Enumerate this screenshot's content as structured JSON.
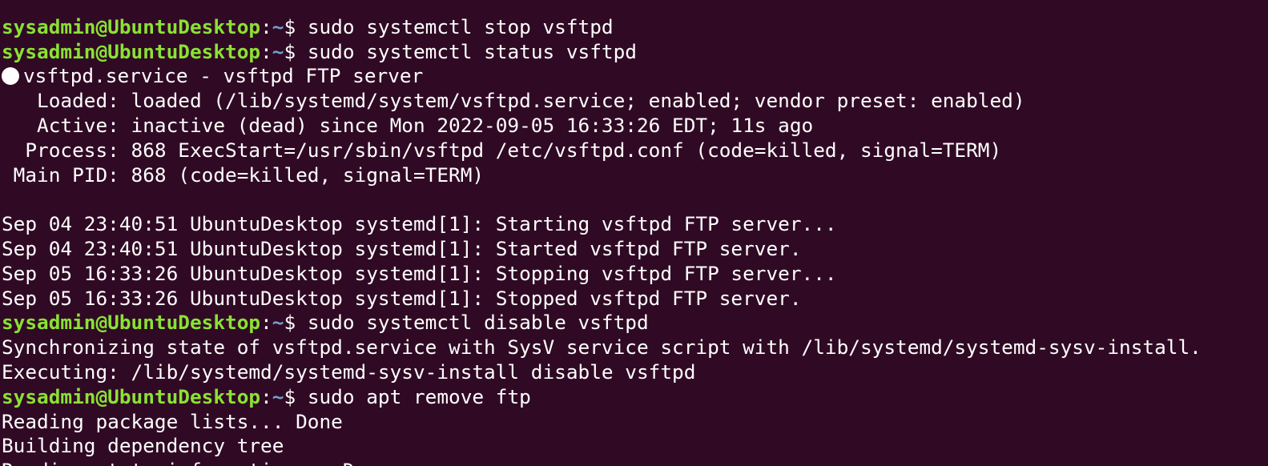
{
  "terminal": {
    "colors": {
      "background": "#300a24",
      "foreground": "#ffffff",
      "prompt_user": "#8ae234",
      "prompt_path": "#729fcf"
    },
    "prompt": {
      "user_host": "sysadmin@UbuntuDesktop",
      "colon": ":",
      "path": "~",
      "symbol": "$ "
    },
    "lines": [
      {
        "type": "output",
        "text": ""
      },
      {
        "type": "prompt",
        "command": "sudo systemctl stop vsftpd"
      },
      {
        "type": "prompt",
        "command": "sudo systemctl status vsftpd"
      },
      {
        "type": "status",
        "text": "vsftpd.service - vsftpd FTP server"
      },
      {
        "type": "output",
        "text": "   Loaded: loaded (/lib/systemd/system/vsftpd.service; enabled; vendor preset: enabled)"
      },
      {
        "type": "output",
        "text": "   Active: inactive (dead) since Mon 2022-09-05 16:33:26 EDT; 11s ago"
      },
      {
        "type": "output",
        "text": "  Process: 868 ExecStart=/usr/sbin/vsftpd /etc/vsftpd.conf (code=killed, signal=TERM)"
      },
      {
        "type": "output",
        "text": " Main PID: 868 (code=killed, signal=TERM)"
      },
      {
        "type": "output",
        "text": ""
      },
      {
        "type": "output",
        "text": "Sep 04 23:40:51 UbuntuDesktop systemd[1]: Starting vsftpd FTP server..."
      },
      {
        "type": "output",
        "text": "Sep 04 23:40:51 UbuntuDesktop systemd[1]: Started vsftpd FTP server."
      },
      {
        "type": "output",
        "text": "Sep 05 16:33:26 UbuntuDesktop systemd[1]: Stopping vsftpd FTP server..."
      },
      {
        "type": "output",
        "text": "Sep 05 16:33:26 UbuntuDesktop systemd[1]: Stopped vsftpd FTP server."
      },
      {
        "type": "prompt",
        "command": "sudo systemctl disable vsftpd"
      },
      {
        "type": "output",
        "text": "Synchronizing state of vsftpd.service with SysV service script with /lib/systemd/systemd-sysv-install."
      },
      {
        "type": "output",
        "text": "Executing: /lib/systemd/systemd-sysv-install disable vsftpd"
      },
      {
        "type": "prompt",
        "command": "sudo apt remove ftp"
      },
      {
        "type": "output",
        "text": "Reading package lists... Done"
      },
      {
        "type": "output",
        "text": "Building dependency tree"
      },
      {
        "type": "output",
        "text": "Reading state information... Done"
      }
    ]
  }
}
